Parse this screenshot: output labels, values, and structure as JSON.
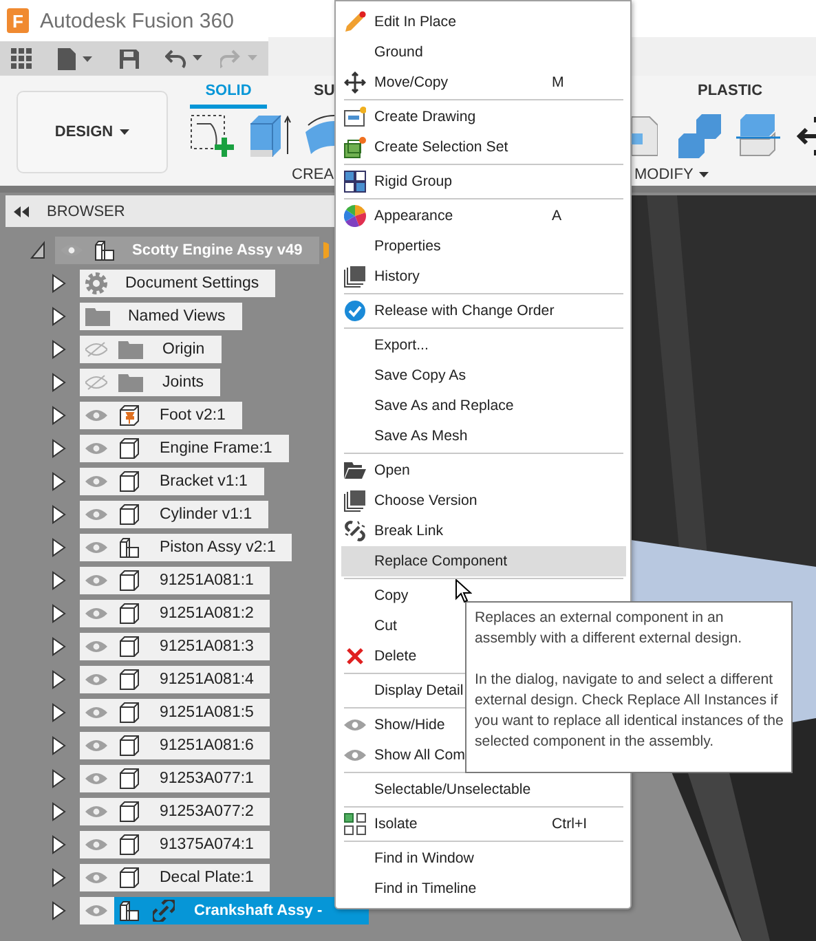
{
  "window": {
    "icon_text": "F",
    "title": "Autodesk Fusion 360"
  },
  "ribbon": {
    "workspace": "DESIGN",
    "tabs": [
      {
        "label": "SOLID",
        "selected": true
      },
      {
        "label": "SU",
        "selected": false
      },
      {
        "label": "PLASTIC",
        "selected": false
      }
    ],
    "groups": [
      "CREA",
      "MODIFY"
    ]
  },
  "browser": {
    "title": "BROWSER",
    "root": {
      "label": "Scotty Engine Assy v49",
      "kind": "assembly",
      "visible": true,
      "expanded": true,
      "children": [
        {
          "label": "Document Settings",
          "kind": "settings",
          "expanded": false,
          "selected": false,
          "linked": false
        },
        {
          "label": "Named Views",
          "kind": "folder",
          "expanded": false,
          "selected": false,
          "linked": false
        },
        {
          "label": "Origin",
          "kind": "folder",
          "visible": false,
          "expanded": false,
          "selected": false,
          "linked": false
        },
        {
          "label": "Joints",
          "kind": "folder",
          "visible": false,
          "expanded": false,
          "selected": false,
          "linked": false
        },
        {
          "label": "Foot v2:1",
          "kind": "grounded",
          "visible": true,
          "expanded": false,
          "selected": false,
          "linked": false
        },
        {
          "label": "Engine Frame:1",
          "kind": "component",
          "visible": true,
          "expanded": false,
          "selected": false,
          "linked": false
        },
        {
          "label": "Bracket v1:1",
          "kind": "component",
          "visible": true,
          "expanded": false,
          "selected": false,
          "linked": false
        },
        {
          "label": "Cylinder v1:1",
          "kind": "component",
          "visible": true,
          "expanded": false,
          "selected": false,
          "linked": false
        },
        {
          "label": "Piston Assy v2:1",
          "kind": "assembly",
          "visible": true,
          "expanded": false,
          "selected": false,
          "linked": false
        },
        {
          "label": "91251A081:1",
          "kind": "component",
          "visible": true,
          "expanded": false,
          "selected": false,
          "linked": false
        },
        {
          "label": "91251A081:2",
          "kind": "component",
          "visible": true,
          "expanded": false,
          "selected": false,
          "linked": false
        },
        {
          "label": "91251A081:3",
          "kind": "component",
          "visible": true,
          "expanded": false,
          "selected": false,
          "linked": false
        },
        {
          "label": "91251A081:4",
          "kind": "component",
          "visible": true,
          "expanded": false,
          "selected": false,
          "linked": false
        },
        {
          "label": "91251A081:5",
          "kind": "component",
          "visible": true,
          "expanded": false,
          "selected": false,
          "linked": false
        },
        {
          "label": "91251A081:6",
          "kind": "component",
          "visible": true,
          "expanded": false,
          "selected": false,
          "linked": false
        },
        {
          "label": "91253A077:1",
          "kind": "component",
          "visible": true,
          "expanded": false,
          "selected": false,
          "linked": false
        },
        {
          "label": "91253A077:2",
          "kind": "component",
          "visible": true,
          "expanded": false,
          "selected": false,
          "linked": false
        },
        {
          "label": "91375A074:1",
          "kind": "component",
          "visible": true,
          "expanded": false,
          "selected": false,
          "linked": false
        },
        {
          "label": "Decal Plate:1",
          "kind": "component",
          "visible": true,
          "expanded": false,
          "selected": false,
          "linked": false
        },
        {
          "label": "Crankshaft Assy -",
          "kind": "assembly",
          "visible": true,
          "expanded": false,
          "selected": true,
          "linked": true
        }
      ]
    }
  },
  "context_menu": {
    "sections": [
      [
        {
          "label": "Edit In Place",
          "kind": "pencil",
          "hovered": false
        },
        {
          "label": "Ground",
          "hovered": false
        },
        {
          "label": "Move/Copy",
          "kind": "move",
          "shortcut": "M",
          "hovered": false
        }
      ],
      [
        {
          "label": "Create Drawing",
          "kind": "drawing",
          "hovered": false
        },
        {
          "label": "Create Selection Set",
          "kind": "selection",
          "hovered": false
        }
      ],
      [
        {
          "label": "Rigid Group",
          "kind": "rigid",
          "hovered": false
        }
      ],
      [
        {
          "label": "Appearance",
          "kind": "appearance",
          "shortcut": "A",
          "hovered": false
        },
        {
          "label": "Properties",
          "hovered": false
        },
        {
          "label": "History",
          "kind": "pages",
          "hovered": false
        }
      ],
      [
        {
          "label": "Release with Change Order",
          "kind": "release",
          "hovered": false
        }
      ],
      [
        {
          "label": "Export...",
          "hovered": false
        },
        {
          "label": "Save Copy As",
          "hovered": false
        },
        {
          "label": "Save As and Replace",
          "hovered": false
        },
        {
          "label": "Save As Mesh",
          "hovered": false
        }
      ],
      [
        {
          "label": "Open",
          "kind": "open",
          "hovered": false
        },
        {
          "label": "Choose Version",
          "kind": "pages",
          "hovered": false
        },
        {
          "label": "Break Link",
          "kind": "breaklink",
          "hovered": false
        },
        {
          "label": "Replace Component",
          "hovered": true
        }
      ],
      [
        {
          "label": "Copy",
          "hovered": false
        },
        {
          "label": "Cut",
          "hovered": false
        },
        {
          "label": "Delete",
          "kind": "delete",
          "hovered": false
        }
      ],
      [
        {
          "label": "Display Detail",
          "hovered": false
        }
      ],
      [
        {
          "label": "Show/Hide",
          "kind": "eye",
          "hovered": false
        },
        {
          "label": "Show All Com",
          "kind": "eye",
          "hovered": false
        }
      ],
      [
        {
          "label": "Selectable/Unselectable",
          "hovered": false
        }
      ],
      [
        {
          "label": "Isolate",
          "kind": "isolate",
          "shortcut": "Ctrl+I",
          "hovered": false
        }
      ],
      [
        {
          "label": "Find in Window",
          "hovered": false
        },
        {
          "label": "Find in Timeline",
          "hovered": false
        }
      ]
    ]
  },
  "tooltip": {
    "paragraphs": [
      "Replaces an external component in an assembly with a different external design.",
      "In the dialog, navigate to and select a different external design. Check Replace All Instances if you want to replace all identical instances of the selected component in the assembly."
    ]
  }
}
